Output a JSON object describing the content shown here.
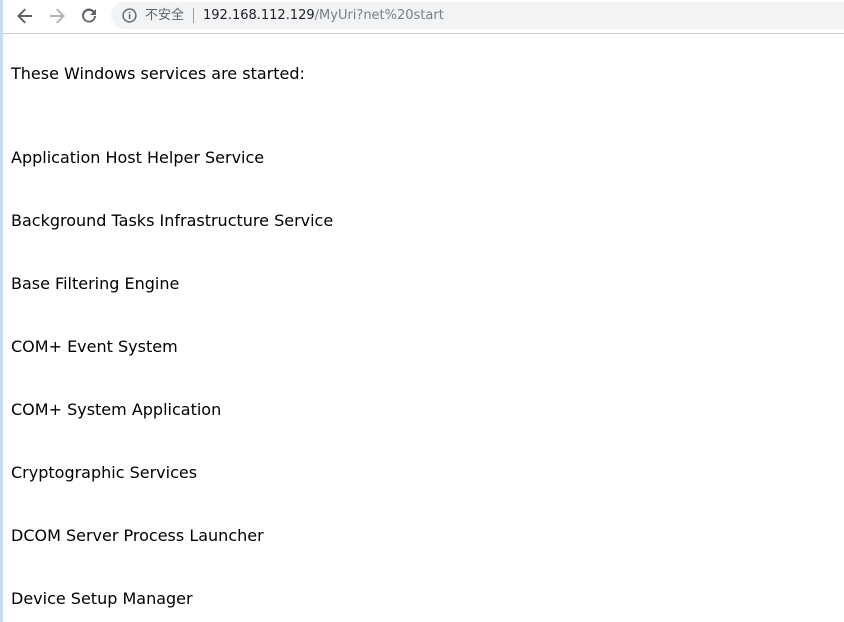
{
  "browser": {
    "security_label": "不安全",
    "url_host": "192.168.112.129",
    "url_path": "/MyUri?net%20start",
    "back_icon": "arrow-left-icon",
    "forward_icon": "arrow-right-icon",
    "reload_icon": "reload-icon",
    "info_icon": "info-icon"
  },
  "page": {
    "intro": "These Windows services are started:",
    "services": [
      "Application Host Helper Service",
      "Background Tasks Infrastructure Service",
      "Base Filtering Engine",
      "COM+ Event System",
      "COM+ System Application",
      "Cryptographic Services",
      "DCOM Server Process Launcher",
      "Device Setup Manager"
    ]
  },
  "colors": {
    "omnibox_bg": "#f1f3f4",
    "text": "#000000",
    "url_path": "#7a7f85"
  }
}
